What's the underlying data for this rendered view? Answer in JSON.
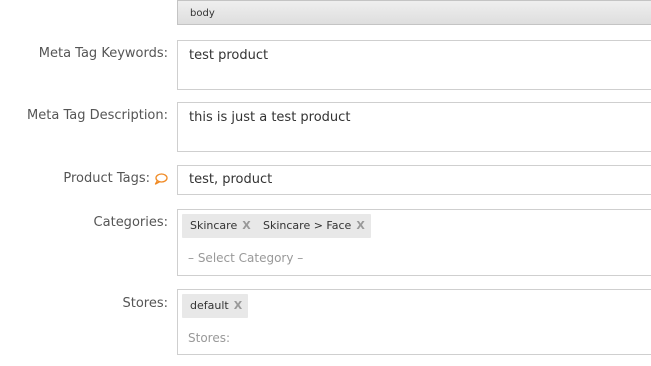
{
  "editor": {
    "path": "body"
  },
  "fields": {
    "meta_keywords": {
      "label": "Meta Tag Keywords:",
      "value": "test product"
    },
    "meta_description": {
      "label": "Meta Tag Description:",
      "value": "this is just a test product"
    },
    "product_tags": {
      "label": "Product Tags:",
      "value": "test, product",
      "icon": "speech-bubble-icon"
    },
    "categories": {
      "label": "Categories:",
      "chips": [
        {
          "label": "Skincare",
          "remove": "X"
        },
        {
          "label": "Skincare > Face",
          "remove": "X"
        }
      ],
      "placeholder": "– Select Category –"
    },
    "stores": {
      "label": "Stores:",
      "chips": [
        {
          "label": "default",
          "remove": "X"
        }
      ],
      "placeholder": "Stores:"
    }
  },
  "colors": {
    "tag_icon": "#f08a24",
    "chip_bg": "#e8e8e8",
    "border": "#cfcfcf"
  }
}
